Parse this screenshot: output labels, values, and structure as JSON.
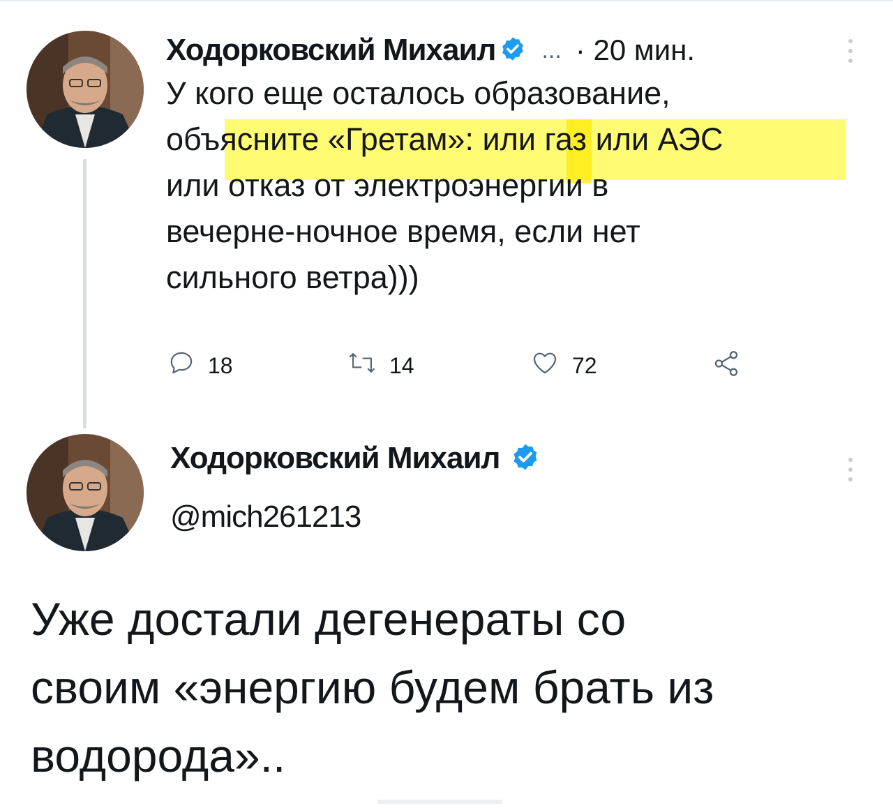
{
  "tweet1": {
    "author": "Ходорковский Михаил",
    "more": "...",
    "time": "· 20 мин.",
    "lines": [
      "У кого еще осталось образование,",
      "объясните «Гретам»: или газ или АЭС",
      "или отказ от электроэнергии в",
      "вечерне-ночное время, если нет",
      "сильного ветра)))"
    ],
    "replies": "18",
    "retweets": "14",
    "likes": "72"
  },
  "tweet2": {
    "author": "Ходорковский Михаил",
    "handle": "@mich261213",
    "lines": [
      "Уже достали дегенераты со",
      "своим «энергию будем брать из",
      "водорода».."
    ]
  },
  "colors": {
    "verified": "#1d9bf0",
    "highlight": "#fff800",
    "icon_gray": "#536471"
  },
  "icons": [
    "verified-icon",
    "reply-icon",
    "retweet-icon",
    "like-icon",
    "share-icon",
    "more-vertical-icon"
  ]
}
